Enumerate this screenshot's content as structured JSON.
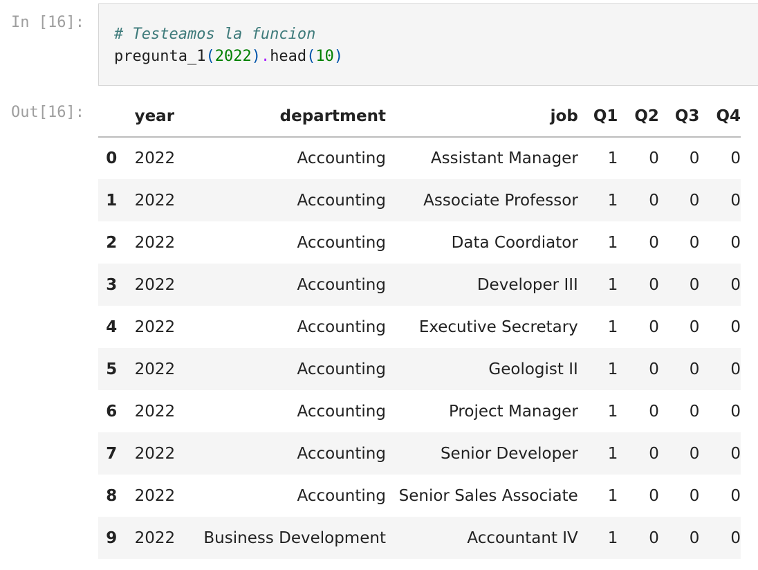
{
  "input_prompt": "In [16]:",
  "output_prompt": "Out[16]:",
  "code": {
    "comment": "# Testeamos la funcion",
    "fn_name": "pregunta_1",
    "open_paren_1": "(",
    "arg_1": "2022",
    "close_paren_1": ")",
    "dot": ".",
    "method": "head",
    "open_paren_2": "(",
    "arg_2": "10",
    "close_paren_2": ")"
  },
  "table": {
    "columns": [
      "year",
      "department",
      "job",
      "Q1",
      "Q2",
      "Q3",
      "Q4"
    ],
    "rows": [
      {
        "index": "0",
        "year": "2022",
        "department": "Accounting",
        "job": "Assistant Manager",
        "Q1": "1",
        "Q2": "0",
        "Q3": "0",
        "Q4": "0"
      },
      {
        "index": "1",
        "year": "2022",
        "department": "Accounting",
        "job": "Associate Professor",
        "Q1": "1",
        "Q2": "0",
        "Q3": "0",
        "Q4": "0"
      },
      {
        "index": "2",
        "year": "2022",
        "department": "Accounting",
        "job": "Data Coordiator",
        "Q1": "1",
        "Q2": "0",
        "Q3": "0",
        "Q4": "0"
      },
      {
        "index": "3",
        "year": "2022",
        "department": "Accounting",
        "job": "Developer III",
        "Q1": "1",
        "Q2": "0",
        "Q3": "0",
        "Q4": "0"
      },
      {
        "index": "4",
        "year": "2022",
        "department": "Accounting",
        "job": "Executive Secretary",
        "Q1": "1",
        "Q2": "0",
        "Q3": "0",
        "Q4": "0"
      },
      {
        "index": "5",
        "year": "2022",
        "department": "Accounting",
        "job": "Geologist II",
        "Q1": "1",
        "Q2": "0",
        "Q3": "0",
        "Q4": "0"
      },
      {
        "index": "6",
        "year": "2022",
        "department": "Accounting",
        "job": "Project Manager",
        "Q1": "1",
        "Q2": "0",
        "Q3": "0",
        "Q4": "0"
      },
      {
        "index": "7",
        "year": "2022",
        "department": "Accounting",
        "job": "Senior Developer",
        "Q1": "1",
        "Q2": "0",
        "Q3": "0",
        "Q4": "0"
      },
      {
        "index": "8",
        "year": "2022",
        "department": "Accounting",
        "job": "Senior Sales Associate",
        "Q1": "1",
        "Q2": "0",
        "Q3": "0",
        "Q4": "0"
      },
      {
        "index": "9",
        "year": "2022",
        "department": "Business Development",
        "job": "Accountant IV",
        "Q1": "1",
        "Q2": "0",
        "Q3": "0",
        "Q4": "0"
      }
    ]
  }
}
